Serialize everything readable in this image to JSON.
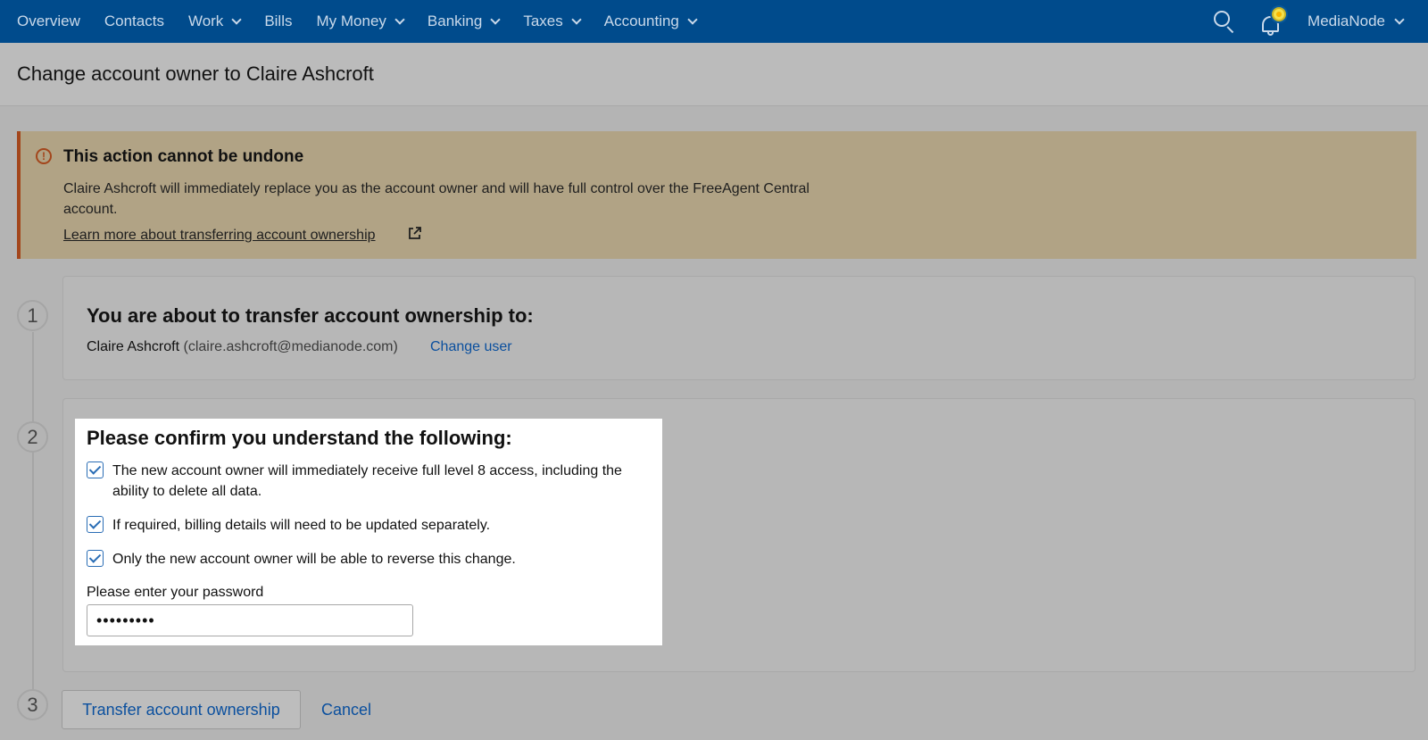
{
  "nav": {
    "items": [
      {
        "label": "Overview",
        "dropdown": false
      },
      {
        "label": "Contacts",
        "dropdown": false
      },
      {
        "label": "Work",
        "dropdown": true
      },
      {
        "label": "Bills",
        "dropdown": false
      },
      {
        "label": "My Money",
        "dropdown": true
      },
      {
        "label": "Banking",
        "dropdown": true
      },
      {
        "label": "Taxes",
        "dropdown": true
      },
      {
        "label": "Accounting",
        "dropdown": true
      }
    ],
    "account_name": "MediaNode",
    "icons": [
      "search-icon",
      "bell-icon",
      "chevron-down-icon"
    ]
  },
  "header": {
    "title": "Change account owner to Claire Ashcroft"
  },
  "warning": {
    "title": "This action cannot be undone",
    "text": "Claire Ashcroft will immediately replace you as the account owner and will have full control over the FreeAgent Central account.",
    "link": "Learn more about transferring account ownership"
  },
  "steps": {
    "one": "1",
    "two": "2",
    "three": "3"
  },
  "step1": {
    "heading": "You are about to transfer account ownership to:",
    "user_name": "Claire Ashcroft",
    "user_email": "(claire.ashcroft@medianode.com)",
    "change_user": "Change user"
  },
  "step2": {
    "heading": "Please confirm you understand the following:",
    "checks": [
      {
        "label": "The new account owner will immediately receive full level 8 access, including the ability to delete all data.",
        "checked": true
      },
      {
        "label": "If required, billing details will need to be updated separately.",
        "checked": true
      },
      {
        "label": "Only the new account owner will be able to reverse this change.",
        "checked": true
      }
    ],
    "password_label": "Please enter your password",
    "password_value": "•••••••••"
  },
  "actions": {
    "transfer": "Transfer account ownership",
    "cancel": "Cancel"
  },
  "colors": {
    "nav_bg": "#004b8c",
    "link": "#0a4f9e",
    "warning_accent": "#a3461c",
    "warning_bg": "#b1a385"
  }
}
